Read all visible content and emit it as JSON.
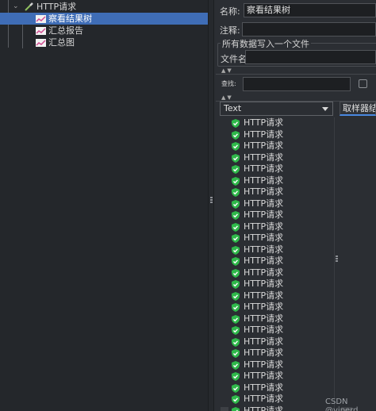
{
  "tree": {
    "items": [
      {
        "label": "HTTP请求",
        "icon": "pipette-icon"
      },
      {
        "label": "察看结果树",
        "icon": "graph-icon",
        "selected": true
      },
      {
        "label": "汇总报告",
        "icon": "graph-icon"
      },
      {
        "label": "汇总图",
        "icon": "graph-icon"
      }
    ]
  },
  "form": {
    "name_label": "名称:",
    "name_value": "察看结果树",
    "comment_label": "注释:",
    "comment_value": "",
    "file_group_title": "所有数据写入一个文件",
    "filename_label": "文件名",
    "filename_value": "",
    "search_label": "查找:",
    "search_value": ""
  },
  "renderer": {
    "selected": "Text"
  },
  "tabs": {
    "sampler_result": "取样器结果"
  },
  "results": [
    "HTTP请求",
    "HTTP请求",
    "HTTP请求",
    "HTTP请求",
    "HTTP请求",
    "HTTP请求",
    "HTTP请求",
    "HTTP请求",
    "HTTP请求",
    "HTTP请求",
    "HTTP请求",
    "HTTP请求",
    "HTTP请求",
    "HTTP请求",
    "HTTP请求",
    "HTTP请求",
    "HTTP请求",
    "HTTP请求",
    "HTTP请求",
    "HTTP请求",
    "HTTP请求",
    "HTTP请求",
    "HTTP请求",
    "HTTP请求",
    "HTTP请求",
    "HTTP请求"
  ],
  "watermark": "CSDN @viperd",
  "colors": {
    "selection": "#3f6db6",
    "success": "#2fb84a",
    "tab_accent": "#4a88e0"
  }
}
